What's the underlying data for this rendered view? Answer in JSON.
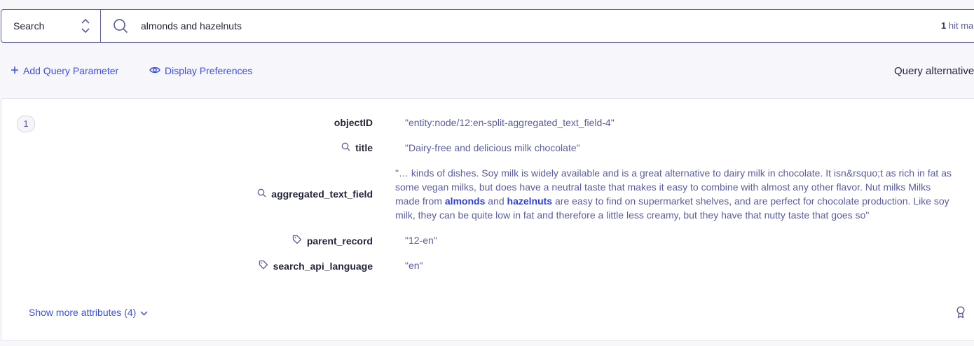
{
  "search": {
    "mode_label": "Search",
    "query": "almonds and hazelnuts",
    "hits_count": "1",
    "hits_suffix": " hit ma"
  },
  "toolbar": {
    "add_param_label": "Add Query Parameter",
    "display_prefs_label": "Display Preferences",
    "query_alt_label": "Query alternative"
  },
  "result": {
    "rank": "1",
    "attributes": {
      "objectID": {
        "key": "objectID",
        "value": "\"entity:node/12:en-split-aggregated_text_field-4\""
      },
      "title": {
        "key": "title",
        "value": "\"Dairy-free and delicious milk chocolate\""
      },
      "aggregated": {
        "key": "aggregated_text_field",
        "part1": "\"… kinds of dishes. Soy milk is widely available and is a great alternative to dairy milk in chocolate. It isn&rsquo;t as rich in fat as some vegan milks, but does have a neutral taste that makes it easy to combine with almost any other flavor. Nut milks Milks made from ",
        "hl1": "almonds",
        "part2": " and ",
        "hl2": "hazelnuts",
        "part3": " are easy to find on supermarket shelves, and are perfect for chocolate production. Like soy milk, they can be quite low in fat and therefore a little less creamy, but they have that nutty taste that goes so\""
      },
      "parent_record": {
        "key": "parent_record",
        "value": "\"12-en\""
      },
      "language": {
        "key": "search_api_language",
        "value": "\"en\""
      }
    },
    "show_more_label": "Show more attributes (4)"
  },
  "colors": {
    "accent": "#3a4fd8",
    "value_text": "#5a5e9a",
    "highlight": "#2d3fd8"
  }
}
